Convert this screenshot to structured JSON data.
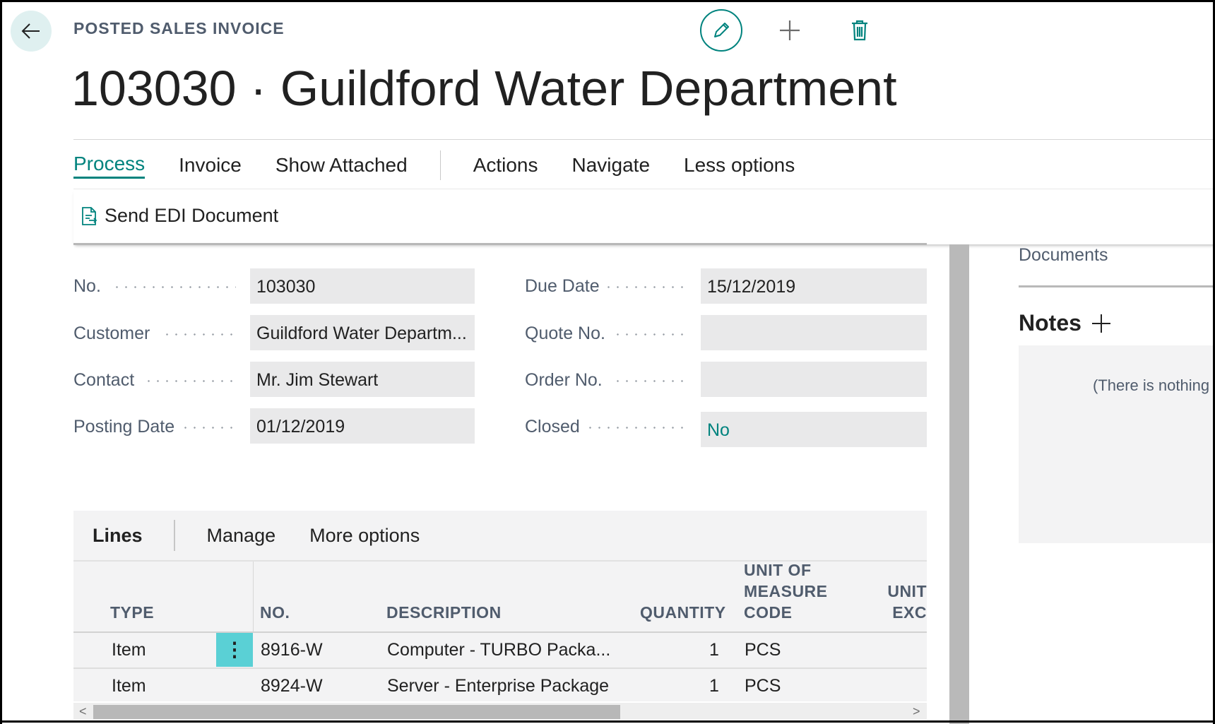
{
  "header": {
    "caption": "POSTED SALES INVOICE",
    "title": "103030 · Guildford Water Department"
  },
  "menu": {
    "items": [
      "Process",
      "Invoice",
      "Show Attached",
      "Actions",
      "Navigate",
      "Less options"
    ]
  },
  "sub_action": {
    "label": "Send EDI Document"
  },
  "fields": {
    "no": {
      "label": "No.",
      "value": "103030"
    },
    "customer": {
      "label": "Customer",
      "value": "Guildford Water Departm..."
    },
    "contact": {
      "label": "Contact",
      "value": "Mr. Jim Stewart"
    },
    "posting_date": {
      "label": "Posting Date",
      "value": "01/12/2019"
    },
    "due_date": {
      "label": "Due Date",
      "value": "15/12/2019"
    },
    "quote_no": {
      "label": "Quote No.",
      "value": ""
    },
    "order_no": {
      "label": "Order No.",
      "value": ""
    },
    "closed": {
      "label": "Closed",
      "value": "No"
    }
  },
  "factbox": {
    "documents_label": "Documents",
    "notes_title": "Notes",
    "notes_empty": "(There is nothing t"
  },
  "lines": {
    "tab": "Lines",
    "actions": [
      "Manage",
      "More options"
    ],
    "columns": {
      "type": "TYPE",
      "no": "NO.",
      "description": "DESCRIPTION",
      "quantity": "QUANTITY",
      "uom_1": "UNIT OF",
      "uom_2": "MEASURE",
      "uom_3": "CODE",
      "unit_1": "UNIT",
      "unit_2": "EXC"
    },
    "rows": [
      {
        "type": "Item",
        "no": "8916-W",
        "description": "Computer - TURBO Packa...",
        "quantity": "1",
        "uom": "PCS"
      },
      {
        "type": "Item",
        "no": "8924-W",
        "description": "Server - Enterprise Package",
        "quantity": "1",
        "uom": "PCS"
      }
    ]
  },
  "colors": {
    "accent": "#00837e",
    "row_menu": "#5ad0d5"
  }
}
